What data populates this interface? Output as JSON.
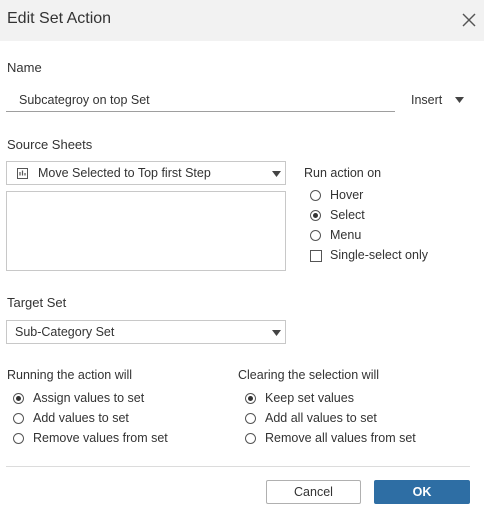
{
  "dialog": {
    "title": "Edit Set Action"
  },
  "name_section": {
    "label": "Name",
    "value": "Subcategroy on top Set",
    "insert_label": "Insert"
  },
  "source_sheets": {
    "label": "Source Sheets",
    "selected": "Move Selected to Top first Step"
  },
  "run_action_on": {
    "label": "Run action on",
    "options": [
      "Hover",
      "Select",
      "Menu"
    ],
    "selected": "Select",
    "single_select_label": "Single-select only",
    "single_select_checked": false
  },
  "target_set": {
    "label": "Target Set",
    "selected": "Sub-Category Set"
  },
  "running_action": {
    "label": "Running the action will",
    "options": [
      "Assign values to set",
      "Add values to set",
      "Remove values from set"
    ],
    "selected": "Assign values to set"
  },
  "clearing_selection": {
    "label": "Clearing the selection will",
    "options": [
      "Keep set values",
      "Add all values to set",
      "Remove all values from set"
    ],
    "selected": "Keep set values"
  },
  "buttons": {
    "cancel": "Cancel",
    "ok": "OK"
  },
  "colors": {
    "ok_button": "#2e6ea4",
    "title_bar": "#f2f2f2"
  }
}
